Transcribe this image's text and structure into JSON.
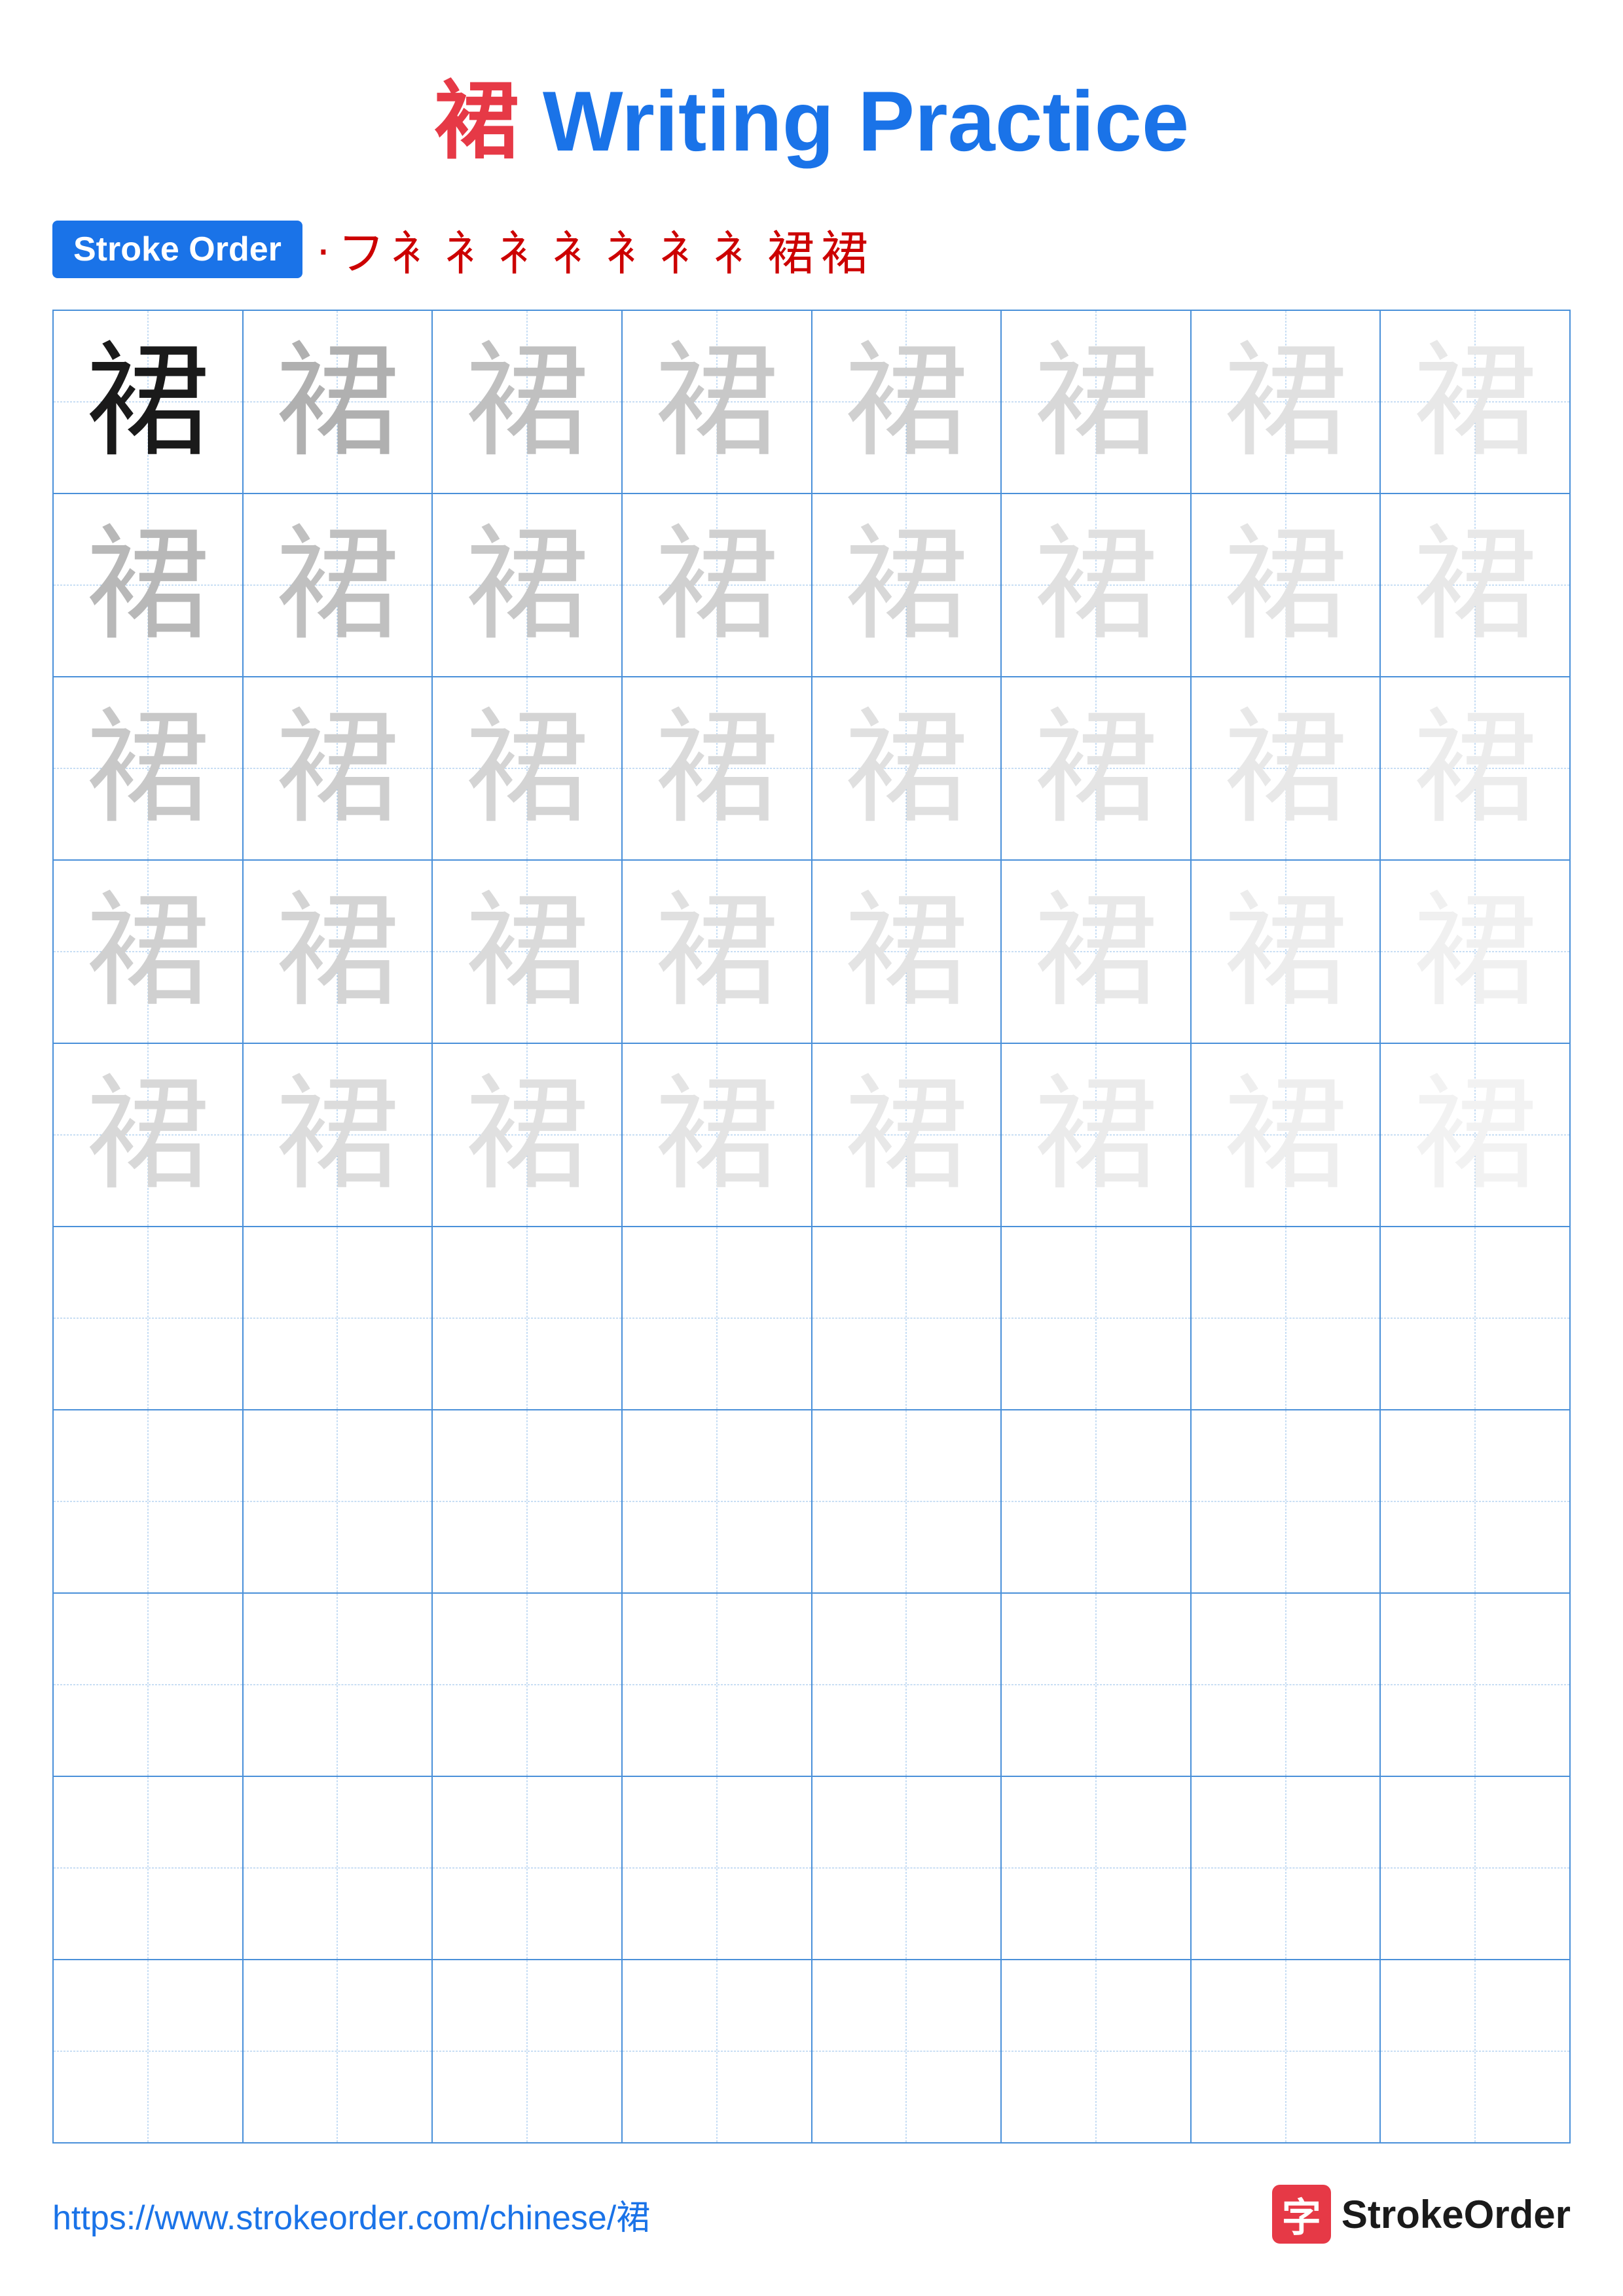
{
  "page": {
    "title_char": "裙",
    "title_text": " Writing Practice",
    "stroke_order_label": "Stroke Order",
    "stroke_order_sequence": [
      "·",
      "フ",
      "衤",
      "衤",
      "衤",
      "衤1",
      "衤†",
      "衤1",
      "衤!",
      "裙",
      "裙"
    ],
    "practice_char": "裙",
    "footer_url": "https://www.strokeorder.com/chinese/裙",
    "footer_logo_text": "StrokeOrder"
  }
}
